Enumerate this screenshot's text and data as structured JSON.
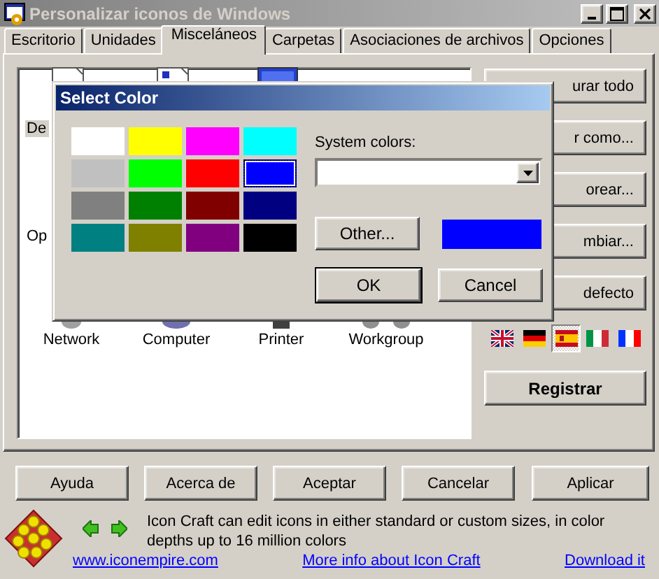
{
  "window": {
    "title": "Personalizar iconos de Windows"
  },
  "tabs": [
    {
      "label": "Escritorio",
      "selected": false
    },
    {
      "label": "Unidades",
      "selected": false
    },
    {
      "label": "Misceláneos",
      "selected": true
    },
    {
      "label": "Carpetas",
      "selected": false
    },
    {
      "label": "Asociaciones de archivos",
      "selected": false
    },
    {
      "label": "Opciones",
      "selected": false
    }
  ],
  "icon_list": {
    "items": [
      {
        "label": "De",
        "selected": true
      },
      {
        "label": "Op",
        "selected": false
      }
    ],
    "bottom_items": [
      {
        "label": "Network"
      },
      {
        "label": "Computer"
      },
      {
        "label": "Printer"
      },
      {
        "label": "Workgroup"
      }
    ]
  },
  "side_buttons": [
    "urar todo",
    "r como...",
    "orear...",
    "mbiar...",
    "defecto"
  ],
  "languages": [
    {
      "kind": "uk",
      "selected": false
    },
    {
      "kind": "de",
      "selected": false
    },
    {
      "kind": "es",
      "selected": true
    },
    {
      "kind": "it",
      "selected": false
    },
    {
      "kind": "fr",
      "selected": false
    }
  ],
  "register_button": "Registrar",
  "buttons": [
    "Ayuda",
    "Acerca de",
    "Aceptar",
    "Cancelar",
    "Aplicar"
  ],
  "footer": {
    "text": "Icon Craft can edit icons in either standard or custom sizes, in color depths up to 16 million colors",
    "links": [
      "www.iconempire.com",
      "More info about Icon Craft",
      "Download it"
    ]
  },
  "dialog": {
    "title": "Select Color",
    "swatches": [
      {
        "color": "#ffffff",
        "selected": false
      },
      {
        "color": "#ffff00",
        "selected": false
      },
      {
        "color": "#ff00ff",
        "selected": false
      },
      {
        "color": "#00ffff",
        "selected": false
      },
      {
        "color": "#c0c0c0",
        "selected": false
      },
      {
        "color": "#00ff00",
        "selected": false
      },
      {
        "color": "#ff0000",
        "selected": false
      },
      {
        "color": "#0000ff",
        "selected": true
      },
      {
        "color": "#808080",
        "selected": false
      },
      {
        "color": "#008000",
        "selected": false
      },
      {
        "color": "#800000",
        "selected": false
      },
      {
        "color": "#000080",
        "selected": false
      },
      {
        "color": "#008080",
        "selected": false
      },
      {
        "color": "#808000",
        "selected": false
      },
      {
        "color": "#800080",
        "selected": false
      },
      {
        "color": "#000000",
        "selected": false
      }
    ],
    "system_colors_label": "System colors:",
    "other_button": "Other...",
    "ok_button": "OK",
    "cancel_button": "Cancel"
  }
}
